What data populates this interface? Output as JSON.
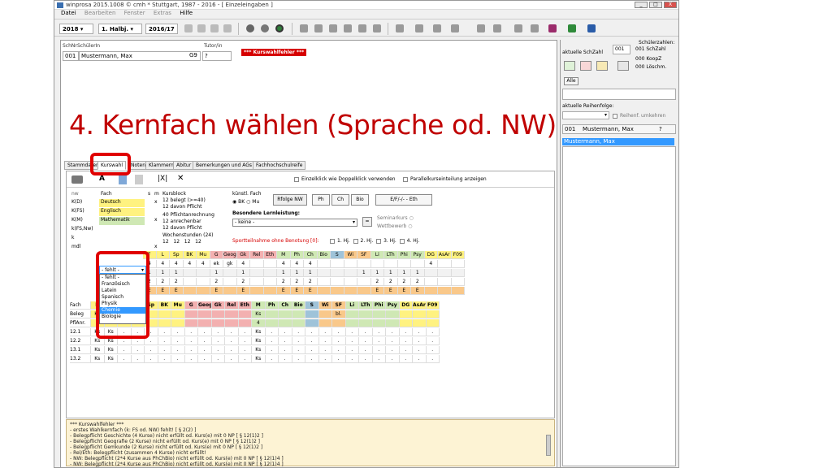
{
  "window": {
    "title": "winprosa 2015.1008 © cmh * Stuttgart, 1987 - 2016 - [ Einzeleingaben ]",
    "buttons": [
      "_",
      "□",
      "X"
    ]
  },
  "menu": [
    "Datei",
    "Bearbeiten",
    "Fenster",
    "Extras",
    "Hilfe"
  ],
  "toolbar": {
    "year": "2018",
    "halbjahr": "1. Halbj.",
    "schuljahr": "2016/17"
  },
  "student_header": {
    "col_schnr": "SchNr",
    "col_schuelerin": "SchülerIn",
    "col_tutor": "Tutor/in",
    "schnr": "001",
    "name": "Mustermann, Max",
    "klasse": "G9",
    "tutor": "?",
    "error_badge": "*** Kurswahlfehler ***"
  },
  "overlay_title": "4. Kernfach wählen (Sprache od. NW)",
  "tabs": [
    "Stammdaten",
    "Kurswahl",
    "Noten",
    "Klammern",
    "Abitur",
    "Bemerkungen und AGs",
    "Fachhochschulreife"
  ],
  "subtoolbar": {
    "opt1": "Einzelklick wie Doppelklick verwenden",
    "opt2": "Parallelkurseinteilung anzeigen"
  },
  "kernfach_table": {
    "headers": [
      "nw",
      "Fach",
      "s",
      "m"
    ],
    "rows": [
      {
        "label": "K(D)",
        "fach": "Deutsch",
        "m": "x"
      },
      {
        "label": "K(FS)",
        "fach": "Englisch",
        "m": ""
      },
      {
        "label": "K(M)",
        "fach": "Mathematik",
        "m": "x"
      },
      {
        "label": "k(FS,Nw)",
        "fach": "- fehlt -",
        "m": ""
      },
      {
        "label": "k",
        "fach": "",
        "m": ""
      },
      {
        "label": "mdl",
        "fach": "",
        "m": "x"
      }
    ]
  },
  "dropdown": {
    "selected": "- fehlt -",
    "options": [
      "- fehlt -",
      "Französisch",
      "Latein",
      "Spanisch",
      "Physik",
      "Chemie",
      "Biologie"
    ],
    "highlighted": "Chemie"
  },
  "kursblock": {
    "title": "Kursblock",
    "belegt": "12 belegt (>=40)",
    "davon_pflicht": "12 davon Pflicht",
    "pflichtanrechnung": "40 Pflichtanrechnung",
    "anrechenbar": "12 anrechenbar",
    "davon_pflicht2": "12 davon Pflicht",
    "wochenstunden_title": "Wochenstunden (24)",
    "wochenstunden": [
      "12",
      "12",
      "12",
      "12"
    ]
  },
  "kuenstl": {
    "title": "künstl. Fach",
    "opt_bk": "BK",
    "opt_mu": "Mu",
    "reihenfolge_btn": "Rfolge NW",
    "buttons": [
      "Ph",
      "Ch",
      "Bio"
    ],
    "ef_btn": "E/F/-/- - Eth",
    "bes_lernleistung": "Besondere Lernleistung:",
    "bes_value": "- keine -",
    "seminarkurs": "Seminarkurs",
    "wettbewerb": "Wettbewerb"
  },
  "sport_text": "Sportteilnahme ohne Benotung [0]:",
  "sport_checks": [
    "1. Hj.",
    "2. Hj.",
    "3. Hj.",
    "4. Hj."
  ],
  "grid": {
    "top_header": [
      "F",
      "L",
      "Sp",
      "BK",
      "Mu",
      "G",
      "Geogr",
      "Gk",
      "Rel",
      "Eth",
      "M",
      "Ph",
      "Ch",
      "Bio",
      "S",
      "Wi",
      "SF",
      "Li",
      "LTh",
      "Phi",
      "Psy",
      "DG",
      "AsAr",
      "F09"
    ],
    "top_rows": [
      [
        "4",
        "4",
        "4",
        "4",
        "4",
        "ek",
        "gk",
        "4",
        "",
        "",
        "4",
        "4",
        "4",
        "",
        "",
        "",
        "",
        "",
        "",
        "",
        "",
        "4",
        "",
        ""
      ],
      [
        "1",
        "1",
        "1",
        "",
        "",
        "1",
        "",
        "1",
        "",
        "",
        "1",
        "1",
        "1",
        "",
        "",
        "",
        "1",
        "1",
        "1",
        "1",
        "1",
        "",
        "",
        ""
      ],
      [
        "2",
        "2",
        "2",
        "",
        "",
        "2",
        "",
        "2",
        "",
        "",
        "2",
        "2",
        "2",
        "",
        "",
        "",
        "",
        "2",
        "2",
        "2",
        "2",
        "",
        "",
        ""
      ],
      [
        "E",
        "E",
        "E",
        "",
        "",
        "E",
        "",
        "E",
        "",
        "",
        "E",
        "E",
        "E",
        "",
        "",
        "",
        "",
        "E",
        "E",
        "E",
        "E",
        "",
        "",
        ""
      ]
    ],
    "bottom_labels": [
      "Fach",
      "Beleg",
      "PflAnr.",
      "12.1",
      "12.2",
      "13.1",
      "13.2"
    ],
    "bottom_header": [
      "D",
      "E",
      "F",
      "L",
      "Sp",
      "BK",
      "Mu",
      "G",
      "Geogr",
      "Gk",
      "Rel",
      "Eth",
      "M",
      "Ph",
      "Ch",
      "Bio",
      "S",
      "Wi",
      "SF",
      "Li",
      "LTh",
      "Phi",
      "Psy",
      "DG",
      "AsAr",
      "F09"
    ],
    "beleg": [
      "Ks",
      "Ks",
      "",
      "",
      "",
      "",
      "",
      "",
      "",
      "",
      "",
      "",
      "Ks",
      "",
      "",
      "",
      "",
      "",
      "bl.",
      "",
      "",
      "",
      "",
      "",
      "",
      ""
    ],
    "pflanr": [
      "4",
      "4",
      "",
      "",
      "",
      "",
      "",
      "",
      "",
      "",
      "",
      "",
      "4",
      "",
      "",
      "",
      "",
      "",
      "",
      "",
      "",
      "",
      "",
      "",
      "",
      ""
    ],
    "sem": [
      "Ks",
      "Ks",
      ".",
      ".",
      ".",
      ".",
      ".",
      ".",
      ".",
      ".",
      ".",
      ".",
      "Ks",
      ".",
      ".",
      ".",
      ".",
      ".",
      ".",
      ".",
      ".",
      ".",
      ".",
      ".",
      ".",
      "."
    ]
  },
  "errors": [
    "*** Kurswahlfehler ***",
    "- erstes Wahlkernfach (k: FS od. NW) fehlt! [ § 2(2) ]",
    "- Belegpflicht Geschichte (4 Kurse) nicht erfüllt od. Kurs(e) mit 0 NP [ § 12(1)2 ]",
    "- Belegpflicht Geografie (2 Kurse) nicht erfüllt od. Kurs(e) mit 0 NP [ § 12(1)2 ]",
    "- Belegpflicht Gemkunde (2 Kurse) nicht erfüllt od. Kurs(e) mit 0 NP [ § 12(1)2 ]",
    "- Rel/Eth: Belegpflicht (zusammen 4 Kurse) nicht erfüllt!",
    "- NW: Belegpflicht (2*4 Kurse aus PhChBio) nicht erfüllt od. Kurs(e) mit 0 NP [ § 12(1)4 ]",
    "- NW: Belegpflicht (2*4 Kurse aus PhChBio) nicht erfüllt od. Kurs(e) mit 0 NP [ § 12(1)4 ]"
  ],
  "right": {
    "schuelerzahlen": "Schülerzahlen:",
    "akt_schzahl": "aktuelle SchZahl",
    "schzahl_value": "001",
    "line1": "001 SchZahl",
    "line2": "000 KoopZ",
    "line3": "000 Löschm.",
    "alle_btn": "Alle",
    "reihenfolge": "aktuelle Reihenfolge:",
    "reihe_umkehren": "Reihenf. umkehren",
    "list_head_nr": "001",
    "list_head_name": "Mustermann, Max",
    "list_head_q": "?",
    "list_item": "Mustermann, Max"
  },
  "colors": {
    "accent_red": "#e00000",
    "yellow": "#fff280",
    "green": "#cfe8b4",
    "red": "#f3b0b0",
    "orange": "#f9c88a",
    "blue_sel": "#3399ff"
  }
}
